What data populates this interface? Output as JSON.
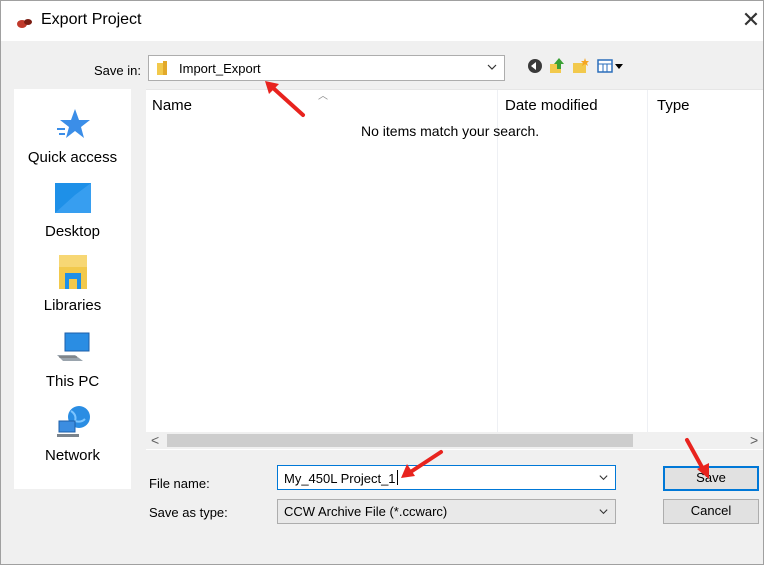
{
  "window": {
    "title": "Export Project",
    "close_label": "✕"
  },
  "save_in": {
    "label": "Save in:",
    "value": "Import_Export"
  },
  "toolbar": {
    "icons": [
      "back-icon",
      "up-folder-icon",
      "new-folder-icon",
      "view-menu-icon"
    ]
  },
  "places": [
    {
      "label": "Quick access",
      "icon": "star-icon"
    },
    {
      "label": "Desktop",
      "icon": "desktop-icon"
    },
    {
      "label": "Libraries",
      "icon": "libraries-icon"
    },
    {
      "label": "This PC",
      "icon": "computer-icon"
    },
    {
      "label": "Network",
      "icon": "network-icon"
    }
  ],
  "list": {
    "columns": [
      "Name",
      "Date modified",
      "Type"
    ],
    "empty_message": "No items match your search."
  },
  "file_name": {
    "label": "File name:",
    "value": "My_450L Project_1"
  },
  "save_as_type": {
    "label": "Save as type:",
    "value": "CCW Archive File (*.ccwarc)"
  },
  "buttons": {
    "save": "Save",
    "cancel": "Cancel"
  },
  "colors": {
    "accent": "#0078d7",
    "annotation_arrow": "#e8231e"
  }
}
